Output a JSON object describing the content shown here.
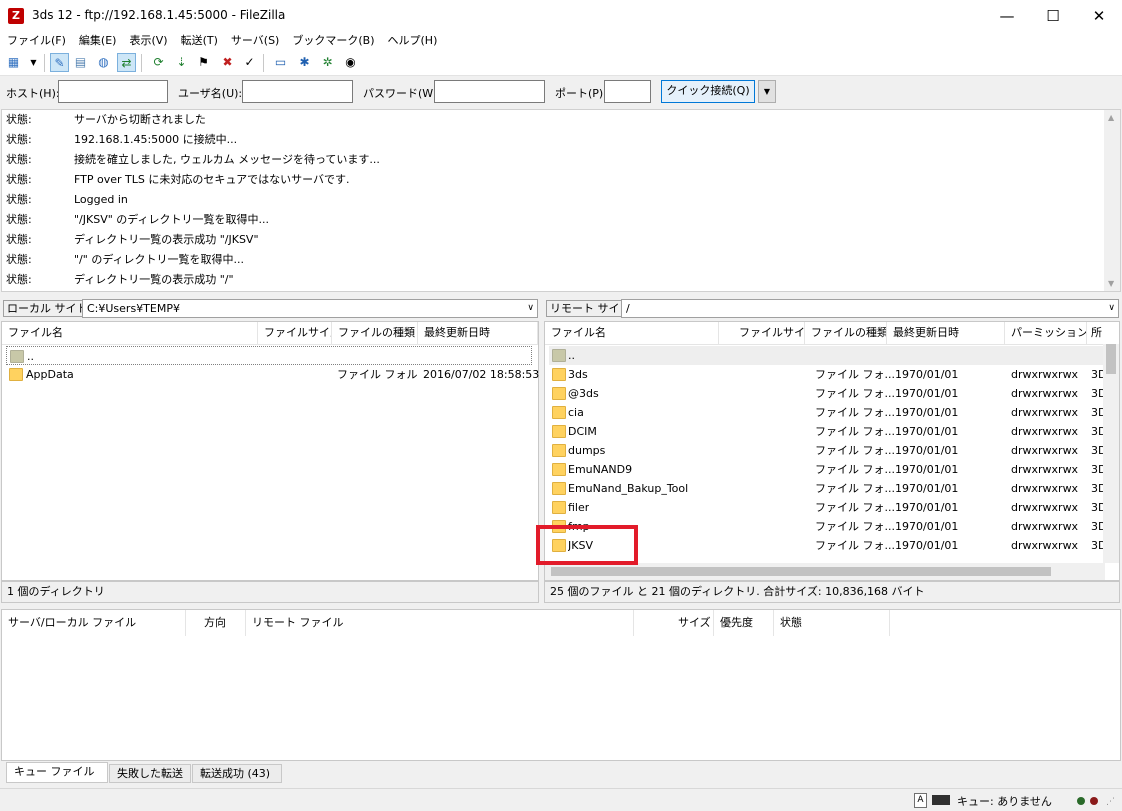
{
  "window": {
    "title": "3ds 12 - ftp://192.168.1.45:5000 - FileZilla",
    "app_icon": "Z",
    "minimize": "—",
    "maximize": "☐",
    "close": "✕"
  },
  "menu": [
    "ファイル(F)",
    "編集(E)",
    "表示(V)",
    "転送(T)",
    "サーバ(S)",
    "ブックマーク(B)",
    "ヘルプ(H)"
  ],
  "quickconnect": {
    "host_label": "ホスト(H):",
    "user_label": "ユーザ名(U):",
    "password_label": "パスワード(W):",
    "port_label": "ポート(P):",
    "button": "クイック接続(Q)",
    "dropdown": "▼"
  },
  "log": [
    {
      "k": "状態:",
      "v": "サーバから切断されました"
    },
    {
      "k": "状態:",
      "v": "192.168.1.45:5000 に接続中..."
    },
    {
      "k": "状態:",
      "v": "接続を確立しました, ウェルカム メッセージを待っています..."
    },
    {
      "k": "状態:",
      "v": "FTP over TLS に未対応のセキュアではないサーバです."
    },
    {
      "k": "状態:",
      "v": "Logged in"
    },
    {
      "k": "状態:",
      "v": "\"/JKSV\" のディレクトリ一覧を取得中..."
    },
    {
      "k": "状態:",
      "v": "ディレクトリ一覧の表示成功 \"/JKSV\""
    },
    {
      "k": "状態:",
      "v": "\"/\" のディレクトリ一覧を取得中..."
    },
    {
      "k": "状態:",
      "v": "ディレクトリ一覧の表示成功 \"/\""
    }
  ],
  "local": {
    "site_label": "ローカル サイト:",
    "path": "C:¥Users¥TEMP¥",
    "columns": [
      "ファイル名",
      "ファイルサイズ",
      "ファイルの種類",
      "最終更新日時"
    ],
    "rows": [
      {
        "name": "..",
        "size": "",
        "type": "",
        "date": ""
      },
      {
        "name": "AppData",
        "size": "",
        "type": "ファイル フォル...",
        "date": "2016/07/02 18:58:53"
      }
    ],
    "status": "1 個のディレクトリ"
  },
  "remote": {
    "site_label": "リモート サイト:",
    "path": "/",
    "columns": [
      "ファイル名",
      "ファイルサイズ",
      "ファイルの種類",
      "最終更新日時",
      "パーミッション",
      "所"
    ],
    "rows": [
      {
        "name": "..",
        "type": "",
        "date": "",
        "perm": "",
        "owner": ""
      },
      {
        "name": "3ds",
        "type": "ファイル フォ...",
        "date": "1970/01/01",
        "perm": "drwxrwxrwx",
        "owner": "3D"
      },
      {
        "name": "@3ds",
        "type": "ファイル フォ...",
        "date": "1970/01/01",
        "perm": "drwxrwxrwx",
        "owner": "3D"
      },
      {
        "name": "cia",
        "type": "ファイル フォ...",
        "date": "1970/01/01",
        "perm": "drwxrwxrwx",
        "owner": "3D"
      },
      {
        "name": "DCIM",
        "type": "ファイル フォ...",
        "date": "1970/01/01",
        "perm": "drwxrwxrwx",
        "owner": "3D"
      },
      {
        "name": "dumps",
        "type": "ファイル フォ...",
        "date": "1970/01/01",
        "perm": "drwxrwxrwx",
        "owner": "3D"
      },
      {
        "name": "EmuNAND9",
        "type": "ファイル フォ...",
        "date": "1970/01/01",
        "perm": "drwxrwxrwx",
        "owner": "3D"
      },
      {
        "name": "EmuNand_Bakup_Tool",
        "type": "ファイル フォ...",
        "date": "1970/01/01",
        "perm": "drwxrwxrwx",
        "owner": "3D"
      },
      {
        "name": "filer",
        "type": "ファイル フォ...",
        "date": "1970/01/01",
        "perm": "drwxrwxrwx",
        "owner": "3D"
      },
      {
        "name": "fmp",
        "type": "ファイル フォ...",
        "date": "1970/01/01",
        "perm": "drwxrwxrwx",
        "owner": "3D"
      },
      {
        "name": "JKSV",
        "type": "ファイル フォ...",
        "date": "1970/01/01",
        "perm": "drwxrwxrwx",
        "owner": "3D"
      }
    ],
    "status": "25 個のファイル と 21 個のディレクトリ. 合計サイズ: 10,836,168 バイト"
  },
  "queue": {
    "columns": [
      "サーバ/ローカル ファイル",
      "方向",
      "リモート ファイル",
      "サイズ",
      "優先度",
      "状態"
    ],
    "tabs": [
      "キュー ファイル",
      "失敗した転送",
      "転送成功 (43)"
    ]
  },
  "statusbar": {
    "queue_text": "キュー: ありません"
  }
}
